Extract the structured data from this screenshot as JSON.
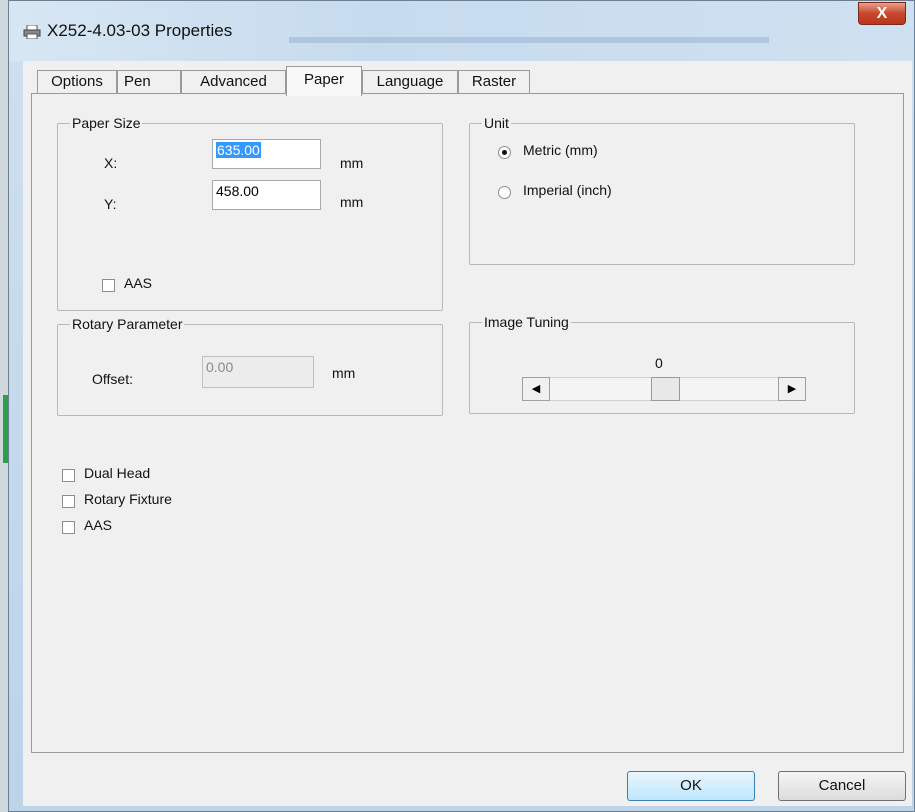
{
  "window": {
    "title": "X252-4.03-03 Properties",
    "close_label": "X"
  },
  "tabs": [
    {
      "label": "Options"
    },
    {
      "label": "Pen"
    },
    {
      "label": "Advanced"
    },
    {
      "label": "Paper"
    },
    {
      "label": "Language"
    },
    {
      "label": "Raster"
    }
  ],
  "active_tab": "Paper",
  "paper_size": {
    "legend": "Paper Size",
    "x_label": "X:",
    "x_value": "635.00",
    "y_label": "Y:",
    "y_value": "458.00",
    "unit": "mm",
    "aas_label": "AAS",
    "aas_checked": false
  },
  "unit": {
    "legend": "Unit",
    "metric_label": "Metric (mm)",
    "imperial_label": "Imperial (inch)",
    "selected": "Metric (mm)"
  },
  "rotary": {
    "legend": "Rotary Parameter",
    "offset_label": "Offset:",
    "offset_value": "0.00",
    "unit": "mm"
  },
  "image_tuning": {
    "legend": "Image Tuning",
    "value_text": "0"
  },
  "options": [
    {
      "label": "Dual Head",
      "checked": false
    },
    {
      "label": "Rotary Fixture",
      "checked": false
    },
    {
      "label": "AAS",
      "checked": false
    }
  ],
  "buttons": {
    "ok": "OK",
    "cancel": "Cancel"
  },
  "colors": {
    "close": "#c7472d",
    "selection": "#3399ff",
    "ok_border": "#3c7fb1"
  },
  "icons": {
    "title_icon": "printer-icon",
    "scroll_left": "arrow-left-icon",
    "scroll_right": "arrow-right-icon"
  }
}
